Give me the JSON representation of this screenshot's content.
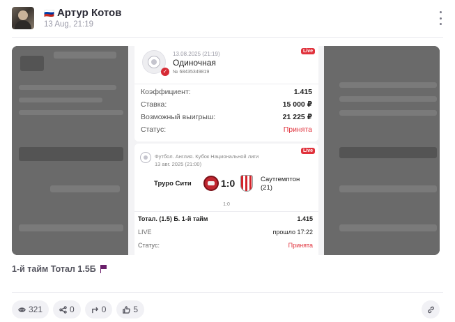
{
  "post": {
    "author_flag": "🇷🇺",
    "author": "Артур Котов",
    "time": "13 Aug, 21:19",
    "caption": "1-й тайм Тотал 1.5Б"
  },
  "ticket": {
    "date": "13.08.2025 (21:19)",
    "type": "Одиночная",
    "number": "№ 68435349819",
    "live": "Live",
    "check": "✓",
    "rows": {
      "coef_label": "Коэффициент:",
      "coef_value": "1.415",
      "stake_label": "Ставка:",
      "stake_value": "15 000 ₽",
      "win_label": "Возможный выигрыш:",
      "win_value": "21 225 ₽",
      "status_label": "Статус:",
      "status_value": "Принята"
    },
    "event": {
      "live": "Live",
      "league": "Футбол. Англия. Кубок Национальной лиги",
      "date": "13 авг. 2025 (21:00)",
      "home": "Труро Сити",
      "score": "1:0",
      "away_line1": "Саутгемптон",
      "away_line2": "(21)",
      "small_score": "1:0",
      "market": "Тотал. (1.5) Б. 1-й тайм",
      "market_value": "1.415",
      "live_label": "LIVE",
      "live_value": "прошло 17:22",
      "status_label": "Статус:",
      "status_value": "Принята"
    }
  },
  "actions": {
    "views": "321",
    "shares": "0",
    "reposts": "0",
    "likes": "5"
  },
  "colors": {
    "accent_red": "#e0323c",
    "caption_flag": "#6a1f6a"
  }
}
